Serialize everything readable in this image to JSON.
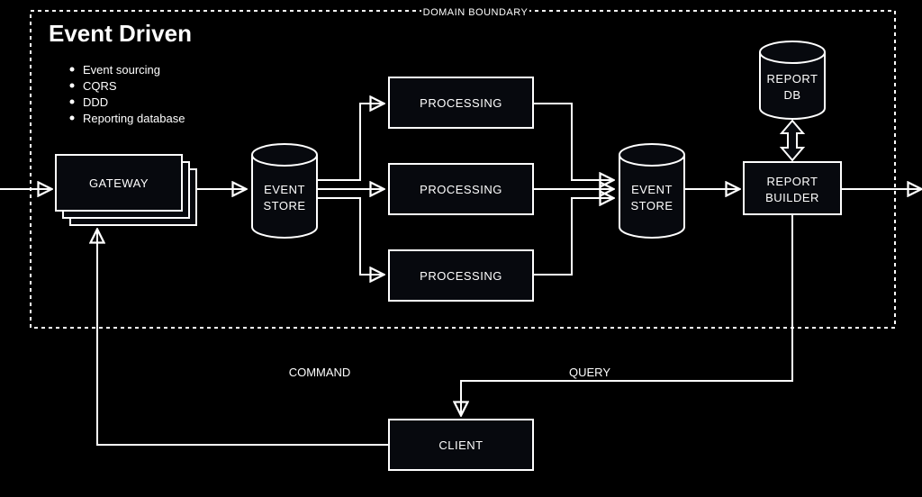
{
  "title": "Event Driven",
  "boundary_label": "DOMAIN BOUNDARY",
  "bullets": [
    "Event sourcing",
    "CQRS",
    "DDD",
    "Reporting database"
  ],
  "nodes": {
    "gateway": "GATEWAY",
    "event_store_1a": "EVENT",
    "event_store_1b": "STORE",
    "processing_1": "PROCESSING",
    "processing_2": "PROCESSING",
    "processing_3": "PROCESSING",
    "event_store_2a": "EVENT",
    "event_store_2b": "STORE",
    "report_builder_a": "REPORT",
    "report_builder_b": "BUILDER",
    "report_db_a": "REPORT",
    "report_db_b": "DB",
    "client": "CLIENT"
  },
  "edges": {
    "command": "COMMAND",
    "query": "QUERY"
  }
}
